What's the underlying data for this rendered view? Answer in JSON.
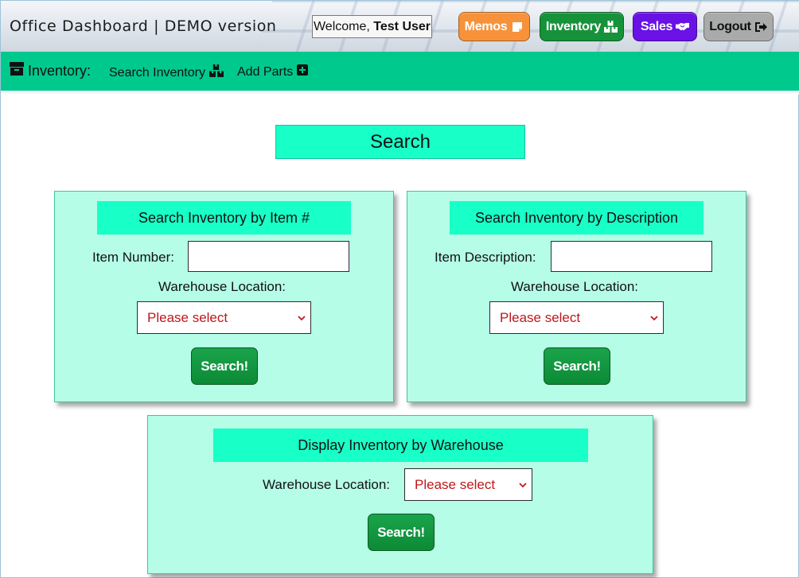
{
  "header": {
    "brand": "Office Dashboard | DEMO version",
    "welcome_prefix": "Welcome,",
    "welcome_user": "Test User",
    "nav": {
      "memos": "Memos",
      "inventory": "Inventory",
      "sales": "Sales",
      "logout": "Logout"
    }
  },
  "subnav": {
    "title": "Inventory:",
    "search_link": "Search Inventory",
    "add_link": "Add Parts"
  },
  "page": {
    "title": "Search"
  },
  "panels": {
    "by_item": {
      "heading": "Search Inventory by Item #",
      "field_label": "Item Number:",
      "field_value": "",
      "location_label": "Warehouse Location:",
      "location_selected": "Please select",
      "button": "Search!"
    },
    "by_description": {
      "heading": "Search Inventory by Description",
      "field_label": "Item Description:",
      "field_value": "",
      "location_label": "Warehouse Location:",
      "location_selected": "Please select",
      "button": "Search!"
    },
    "by_warehouse": {
      "heading": "Display Inventory by Warehouse",
      "location_label": "Warehouse Location:",
      "location_selected": "Please select",
      "button": "Search!"
    }
  },
  "colors": {
    "subnav_bg": "#00c98d",
    "panel_bg": "#b5fde7",
    "heading_bg": "#19ffc8",
    "search_button": "#16923a",
    "memos_button": "#f7923a",
    "sales_button": "#6a11e6",
    "logout_button": "#a9aaaa",
    "select_text": "#c0171b"
  },
  "icons": {
    "memos": "sticky-note-icon",
    "inventory": "boxes-icon",
    "sales": "handshake-icon",
    "logout": "sign-out-icon",
    "subnav": "archive-icon",
    "add": "plus-square-icon",
    "select": "chevron-down-icon"
  }
}
